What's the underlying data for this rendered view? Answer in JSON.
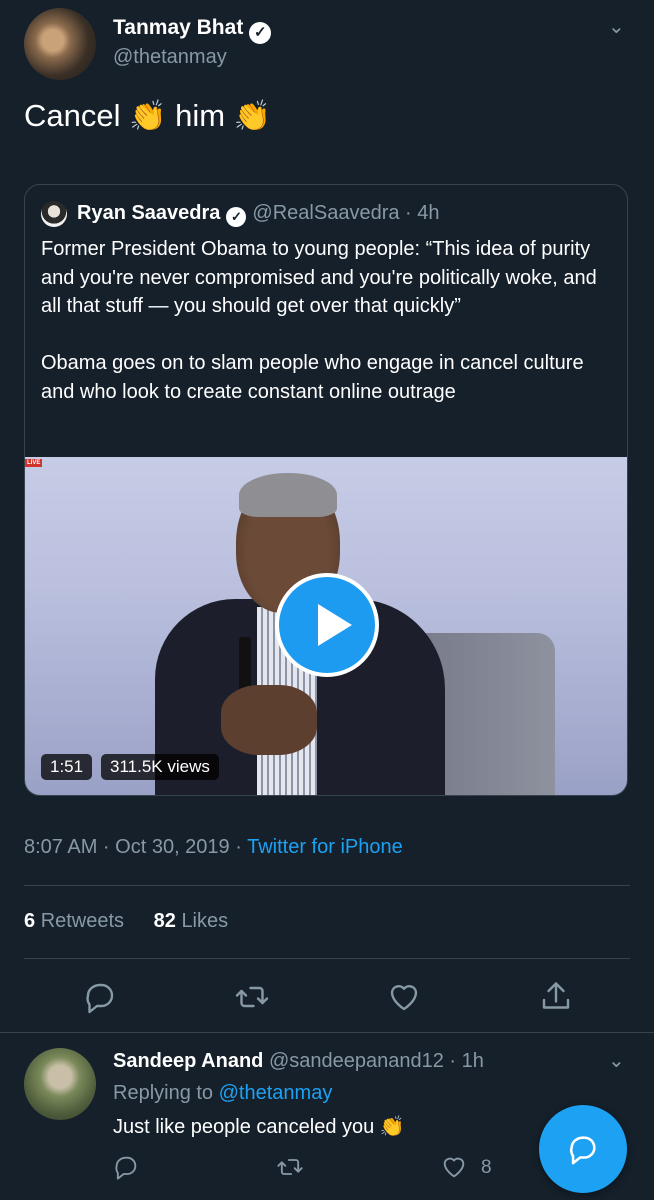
{
  "tweet": {
    "author_name": "Tanmay Bhat",
    "author_handle": "@thetanmay",
    "text_word1": "Cancel",
    "text_word2": "him",
    "emoji": "👏",
    "timestamp": "8:07 AM · Oct 30, 2019 · ",
    "source": "Twitter for iPhone",
    "retweets_count": "6",
    "retweets_label": "Retweets",
    "likes_count": "82",
    "likes_label": "Likes"
  },
  "quoted_tweet": {
    "author_name": "Ryan Saavedra",
    "author_handle": "@RealSaavedra",
    "age": "· 4h",
    "text": "Former President Obama to young people: “This idea of purity and you're never compromised and you're politically woke, and all that stuff — you should get over that quickly”\n\nObama goes on to slam people who engage in cancel culture and who look to create constant online outrage",
    "video": {
      "live_tag": "LIVE",
      "duration": "1:51",
      "views": "311.5K views"
    }
  },
  "reply": {
    "author_name": "Sandeep Anand",
    "author_handle": "@sandeepanand12",
    "age": "· 1h",
    "replying_prefix": "Replying to ",
    "replying_to": "@thetanmay",
    "text": "Just like people canceled you",
    "emoji": "👏",
    "like_count": "8"
  },
  "icons": {
    "verified": "verified-icon",
    "caret": "chevron-down-icon",
    "reply": "reply-icon",
    "retweet": "retweet-icon",
    "like": "heart-icon",
    "share": "share-icon",
    "compose": "compose-reply-icon"
  },
  "colors": {
    "background": "#15202b",
    "accent": "#1da1f2",
    "muted": "#8899a6",
    "divider": "#38444d"
  }
}
